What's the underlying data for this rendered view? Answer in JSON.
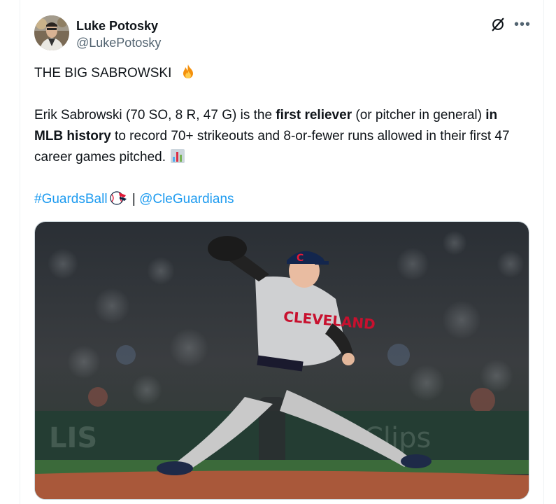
{
  "author": {
    "display_name": "Luke Potosky",
    "handle": "@LukePotosky"
  },
  "icons": {
    "grok": "grok-icon",
    "more": "more-icon",
    "fire": "fire-emoji",
    "chart": "bar-chart-emoji",
    "team_logo": "guardians-ball-icon"
  },
  "tweet": {
    "headline": "THE BIG SABROWSKI",
    "body_part1": "Erik Sabrowski (70 SO, 8 R, 47 G) is the ",
    "body_bold1": "first reliever",
    "body_part2": " (or pitcher in general) ",
    "body_bold2": "in MLB history",
    "body_part3": " to record 70+ strikeouts and 8-or-fewer runs allowed in their first 47 career games pitched.",
    "hashtag": "#GuardsBall",
    "separator": " | ",
    "mention": "@CleGuardians"
  },
  "photo": {
    "jersey_text": "CLEVELAND",
    "background_sign": "Clips"
  },
  "colors": {
    "link": "#1d9bf0",
    "text": "#0f1419",
    "secondary": "#536471"
  }
}
